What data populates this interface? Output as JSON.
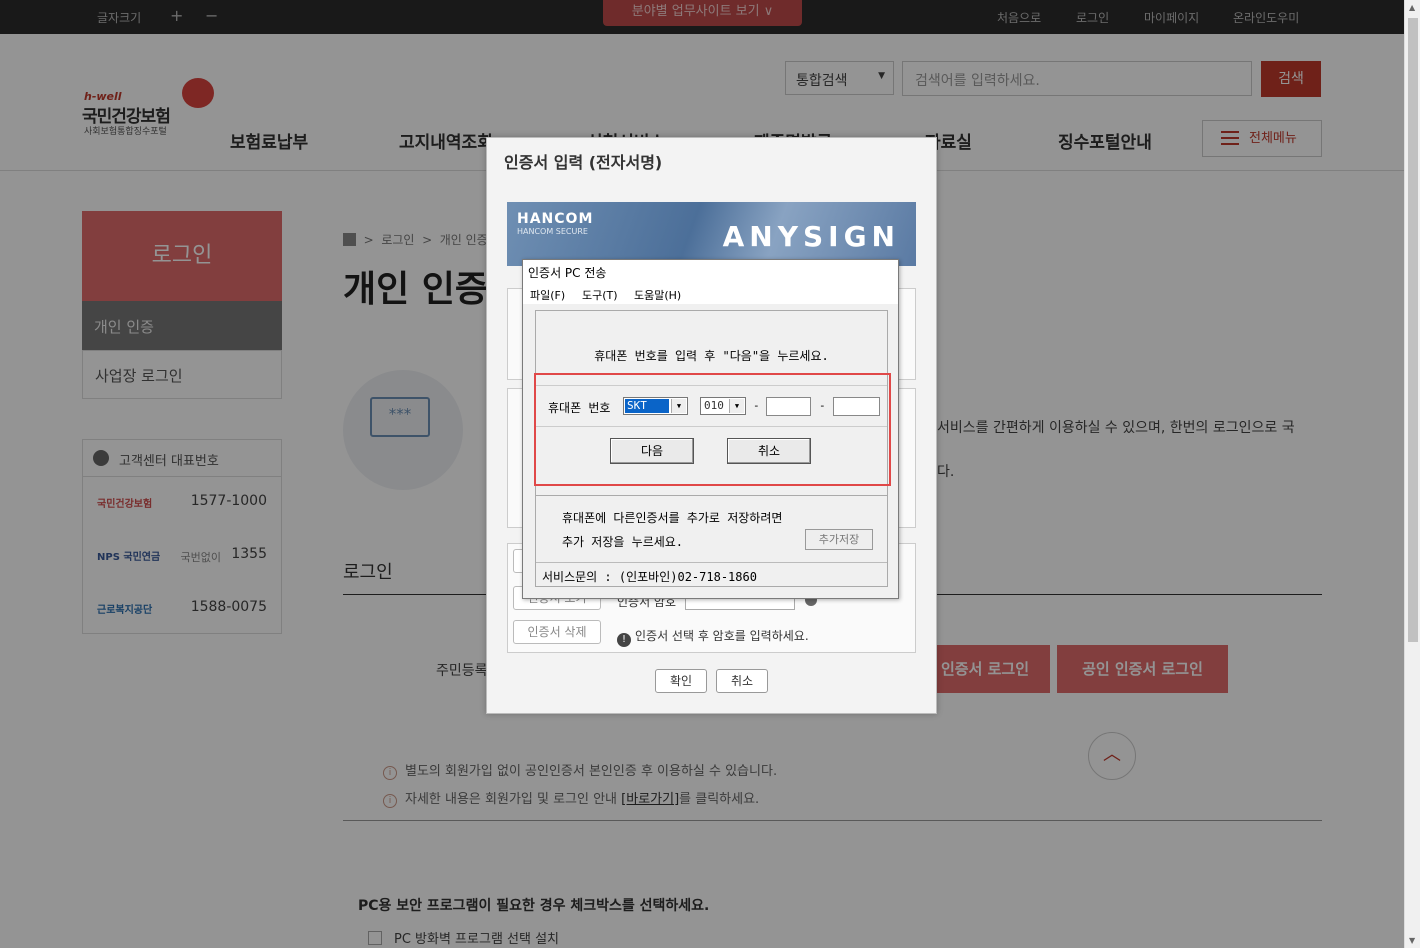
{
  "topbar": {
    "font_size_label": "글자크기",
    "plus": "+",
    "minus": "−",
    "site_dropdown": "분야별 업무사이트 보기 ∨",
    "links": [
      "처음으로",
      "로그인",
      "마이페이지",
      "온라인도우미"
    ]
  },
  "logo": {
    "en": "h-well",
    "ko": "국민건강보험",
    "sub": "사회보험통합징수포털"
  },
  "search": {
    "scope": "통합검색",
    "scope_arrow": "▼",
    "placeholder": "검색어를 입력하세요.",
    "button": "검색"
  },
  "nav": {
    "items": [
      "보험료납부",
      "고지내역조회",
      "신청서비스",
      "제증명발급",
      "자료실",
      "징수포털안내"
    ],
    "all_menu": "전체메뉴"
  },
  "sidebar": {
    "title": "로그인",
    "items": [
      "개인 인증",
      "사업장 로그인"
    ],
    "cs_title": "고객센터 대표번호",
    "cs_rows": [
      {
        "org": "국민건강보험",
        "num": "1577-1000"
      },
      {
        "org": "NPS 국민연금",
        "prefix": "국번없이",
        "num": "1355"
      },
      {
        "org": "근로복지공단",
        "num": "1588-0075"
      }
    ]
  },
  "main": {
    "breadcrumb": [
      "로그인",
      "개인 인증"
    ],
    "title": "개인 인증",
    "body_line1": "서비스를 간편하게 이용하실 수 있으며, 한번의 로그인으로 국",
    "body_line2": "다.",
    "login_heading": "로그인",
    "resident_label": "주민등록",
    "buttons": [
      "인증서 로그인",
      "공인 인증서 로그인"
    ],
    "notes": [
      "별도의 회원가입 없이 공인인증서 본인인증 후 이용하실 수 있습니다.",
      {
        "before": "자세한 내용은 회원가입 및 로그인 안내 ",
        "link": "[바로가기]",
        "after": "를 클릭하세요."
      }
    ],
    "pc_heading": "PC용 보안 프로그램이 필요한 경우 체크박스를 선택하세요.",
    "pc_option": "PC 방화벽 프로그램 선택 설치"
  },
  "anysign": {
    "title": "인증서 입력 (전자서명)",
    "brand": "HANCOM",
    "brand_sub": "HANCOM SECURE",
    "product": "ANYSIGN",
    "view_cert": "인증서 보기",
    "delete_cert": "인증서 삭제",
    "pw_label": "인증서 암호",
    "warning": "인증서 선택 후 암호를 입력하세요.",
    "ok": "확인",
    "cancel": "취소"
  },
  "pc_transfer": {
    "title": "인증서 PC 전송",
    "menu": [
      "파일(F)",
      "도구(T)",
      "도움말(H)"
    ],
    "instruction": "휴대폰 번호를 입력 후 \"다음\"을 누르세요.",
    "phone_label": "휴대폰 번호",
    "carrier": "SKT",
    "prefix": "010",
    "dash": "-",
    "next": "다음",
    "cancel": "취소",
    "extra_line1": "휴대폰에 다른인증서를 추가로 저장하려면",
    "extra_line2": "추가 저장을 누르세요.",
    "add_save": "추가저장",
    "service": "서비스문의 : (인포바인)02-718-1860"
  }
}
